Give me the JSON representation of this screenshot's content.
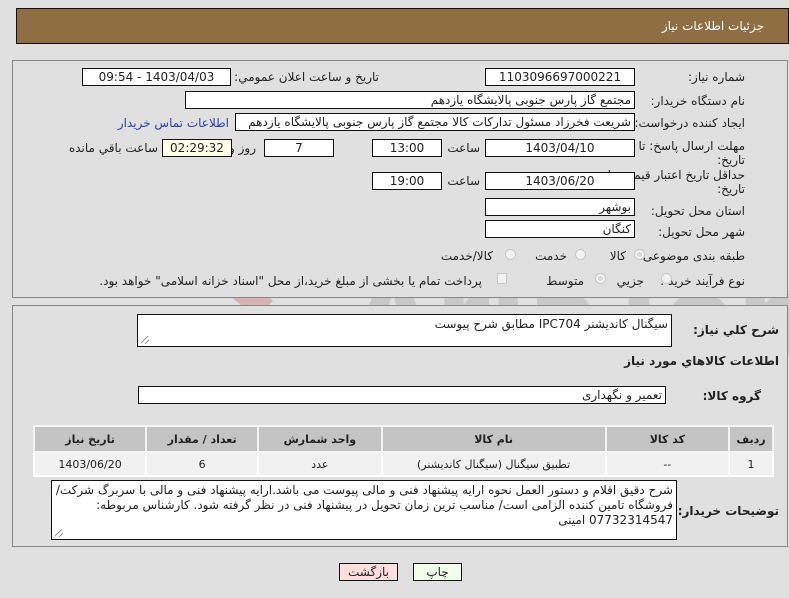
{
  "header": {
    "title": "جزئيات اطلاعات نياز"
  },
  "form": {
    "need_number": {
      "label": "شماره نياز:",
      "value": "1103096697000221"
    },
    "announce_datetime": {
      "label": "تاريخ و ساعت اعلان عمومي:",
      "value": "1403/04/03 - 09:54"
    },
    "buyer_org": {
      "label": "نام دستگاه خريدار:",
      "value": "مجتمع گاز پارس جنوبی  پالایشگاه یازدهم"
    },
    "requester": {
      "label": "ايجاد كننده درخواست:",
      "value": "شریعت فخرزاد مسئول تداركات كالا مجتمع گاز پارس جنوبی  پالایشگاه یازدهم",
      "contact_link": "اطلاعات تماس خريدار"
    },
    "reply_deadline": {
      "label_line1": "مهلت ارسال پاسخ: تا",
      "label_line2": "تاريخ:",
      "date": "1403/04/10",
      "time_label": "ساعت",
      "time": "13:00",
      "days": "7",
      "days_label": "روز و",
      "remaining": "02:29:32",
      "remaining_label": "ساعت باقي مانده"
    },
    "price_validity": {
      "label_line1": "حداقل تاريخ اعتبار قيمت: تا",
      "label_line2": "تاريخ:",
      "date": "1403/06/20",
      "time_label": "ساعت",
      "time": "19:00"
    },
    "delivery_province": {
      "label": "استان محل تحويل:",
      "value": "بوشهر"
    },
    "delivery_city": {
      "label": "شهر محل تحويل:",
      "value": "کنگان"
    },
    "category": {
      "label": "طبقه بندی موضوعی:",
      "options": [
        "كالا",
        "خدمت",
        "كالا/خدمت"
      ],
      "selected": "كالا"
    },
    "purchase_type": {
      "label": "نوع فرآيند خريد :",
      "options": [
        "جزيي",
        "متوسط"
      ],
      "selected": "متوسط",
      "treasury_checkbox_label": "پرداخت تمام يا بخشی از مبلغ خريد،از محل \"اسناد خزانه اسلامی\" خواهد بود."
    }
  },
  "description": {
    "label": "شرح كلي نياز:",
    "value": "سیگنال کاندیشنر IPC704 مطابق شرح پیوست"
  },
  "goods_section": {
    "title": "اطلاعات كالاهاي مورد نياز",
    "group_label": "گروه كالا:",
    "group_value": "تعمیر و نگهداری"
  },
  "table": {
    "headers": [
      "رديف",
      "كد كالا",
      "نام كالا",
      "واحد شمارش",
      "تعداد / مقدار",
      "تاريخ نياز"
    ],
    "rows": [
      [
        "1",
        "--",
        "تطبیق سیگنال (سیگنال کاندیشنر)",
        "عدد",
        "6",
        "1403/06/20"
      ]
    ]
  },
  "buyer_notes": {
    "label": "توضيحات خريدار:",
    "value": "شرح دقیق اقلام و دستور العمل نحوه ارایه پیشنهاد فنی و مالی پیوست می باشد.ارایه پیشنهاد فنی و مالی با سربرگ شرکت/فروشگاه تامین کننده الزامی است/ مناسب ترین زمان تحویل در پیشنهاد فنی در نظر گرفته شود. کارشناس مربوطه: 07732314547 امینی"
  },
  "buttons": {
    "print": "چاپ",
    "back": "بازگشت"
  },
  "watermark": {
    "text": "AriaTender.net"
  },
  "colors": {
    "header": "#8e6e42",
    "link": "#2b3fb0",
    "print_bg": "#efffea",
    "back_bg": "#ffdede"
  }
}
